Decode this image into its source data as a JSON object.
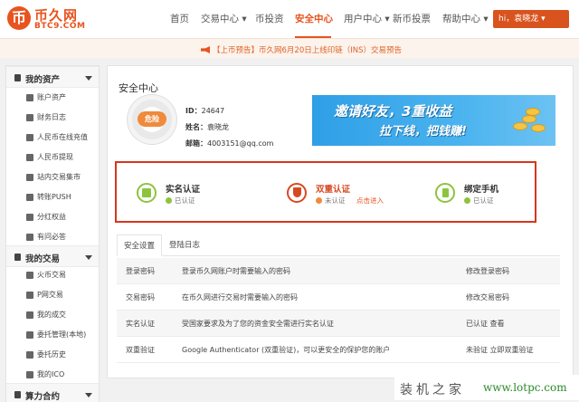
{
  "logo": {
    "coin_glyph": "币",
    "cn": "币久网",
    "en": "BTC9.COM",
    "color": "#e8531e"
  },
  "nav": {
    "items": [
      "首页",
      "交易中心",
      "币投资",
      "安全中心",
      "用户中心",
      "新币投票",
      "帮助中心"
    ],
    "active": "安全中心",
    "user_label": "hi，袁晓龙"
  },
  "announcement": "【上币预告】币久网6月20日上线印链（INS）交易预告",
  "sidebar": {
    "groups": [
      {
        "label": "我的资产",
        "icon": "wallet-icon",
        "items": [
          {
            "label": "账户资产",
            "icon": "account-icon"
          },
          {
            "label": "财务日志",
            "icon": "log-icon"
          },
          {
            "label": "人民币在线充值",
            "icon": "recharge-icon"
          },
          {
            "label": "人民币提现",
            "icon": "withdraw-icon"
          },
          {
            "label": "站内交易集市",
            "icon": "market-icon"
          },
          {
            "label": "转账PUSH",
            "icon": "transfer-icon"
          },
          {
            "label": "分红权益",
            "icon": "dividend-icon"
          },
          {
            "label": "有问必答",
            "icon": "qa-icon"
          }
        ]
      },
      {
        "label": "我的交易",
        "icon": "trade-icon",
        "items": [
          {
            "label": "火币交易",
            "icon": "fire-icon"
          },
          {
            "label": "P网交易",
            "icon": "p-icon"
          },
          {
            "label": "我的成交",
            "icon": "deal-icon"
          },
          {
            "label": "委托管理(本地)",
            "icon": "order-icon"
          },
          {
            "label": "委托历史",
            "icon": "history-icon"
          },
          {
            "label": "我的ICO",
            "icon": "ico-icon"
          }
        ]
      },
      {
        "label": "算力合约",
        "icon": "contract-icon",
        "items": []
      }
    ]
  },
  "security": {
    "title": "安全中心",
    "risk_label": "危险",
    "id_label": "ID：",
    "id_value": "24647",
    "name_label": "姓名：",
    "name_value": "袁晓龙",
    "email_label": "邮箱：",
    "email_value": "4003151@qq.com",
    "banner": {
      "line1": "邀请好友，3重收益",
      "line2": "拉下线，把钱赚!"
    },
    "verifications": [
      {
        "title": "实名认证",
        "status": "已认证",
        "state": "ok",
        "icon": "id-card-icon"
      },
      {
        "title": "双重认证",
        "status": "未认证",
        "state": "warn",
        "icon": "shield-icon",
        "link": "点击进入"
      },
      {
        "title": "绑定手机",
        "status": "已认证",
        "state": "ok",
        "icon": "phone-icon"
      }
    ],
    "tabs": [
      "安全设置",
      "登陆日志"
    ],
    "active_tab": "安全设置",
    "rows": [
      {
        "name": "登录密码",
        "desc": "登录币久网账户时需要输入的密码",
        "action": "修改登录密码"
      },
      {
        "name": "交易密码",
        "desc": "在币久网进行交易时需要输入的密码",
        "action": "修改交易密码"
      },
      {
        "name": "实名认证",
        "desc": "受国家要求及为了您的资金安全需进行实名认证",
        "action": "已认证 查看"
      },
      {
        "name": "双重验证",
        "desc": "Google Authenticator (双重验证)，可以更安全的保护您的账户",
        "action": "未验证 立即双重验证"
      }
    ]
  },
  "watermark": {
    "cn": "装机之家",
    "url": "www.lotpc.com"
  }
}
